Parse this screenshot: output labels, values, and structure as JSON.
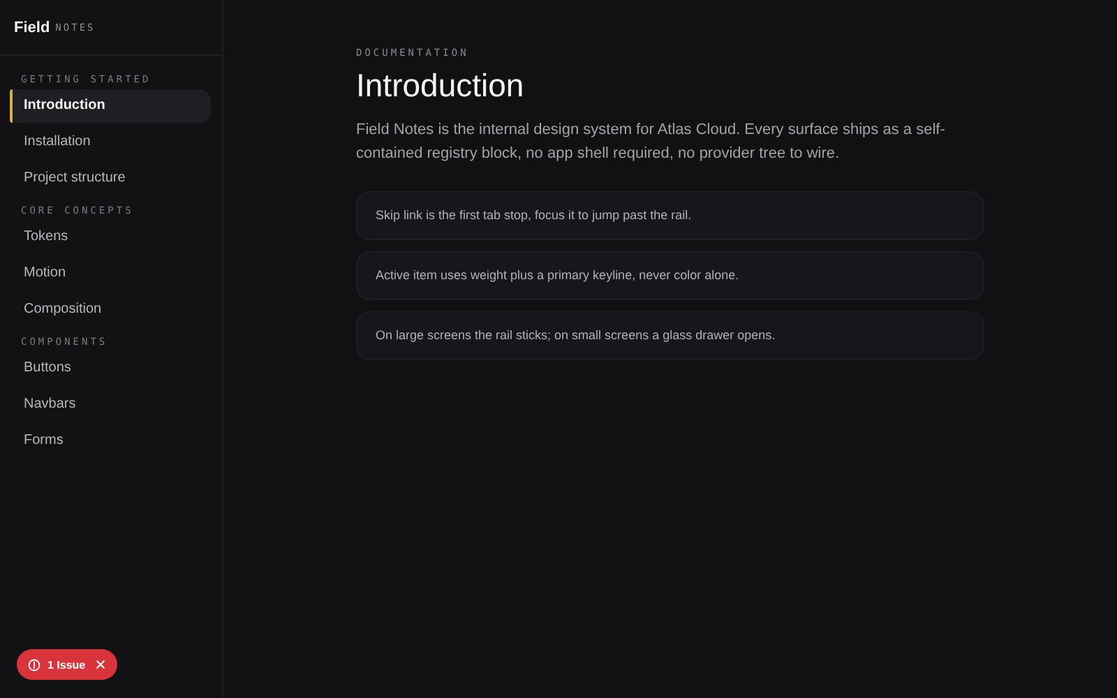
{
  "brand": {
    "name": "Field",
    "suffix": "NOTES"
  },
  "sidebar": {
    "sections": [
      {
        "title": "GETTING STARTED",
        "items": [
          {
            "label": "Introduction",
            "selected": true
          },
          {
            "label": "Installation",
            "selected": false
          },
          {
            "label": "Project structure",
            "selected": false
          }
        ]
      },
      {
        "title": "CORE CONCEPTS",
        "items": [
          {
            "label": "Tokens",
            "selected": false
          },
          {
            "label": "Motion",
            "selected": false
          },
          {
            "label": "Composition",
            "selected": false
          }
        ]
      },
      {
        "title": "COMPONENTS",
        "items": [
          {
            "label": "Buttons",
            "selected": false
          },
          {
            "label": "Navbars",
            "selected": false
          },
          {
            "label": "Forms",
            "selected": false
          }
        ]
      }
    ]
  },
  "main": {
    "eyebrow": "DOCUMENTATION",
    "title": "Introduction",
    "lead": "Field Notes is the internal design system for Atlas Cloud. Every surface ships as a self-contained registry block, no app shell required, no provider tree to wire.",
    "notes": [
      "Skip link is the first tab stop, focus it to jump past the rail.",
      "Active item uses weight plus a primary keyline, never color alone.",
      "On large screens the rail sticks; on small screens a glass drawer opens."
    ]
  },
  "issue_badge": {
    "label": "1 Issue"
  }
}
